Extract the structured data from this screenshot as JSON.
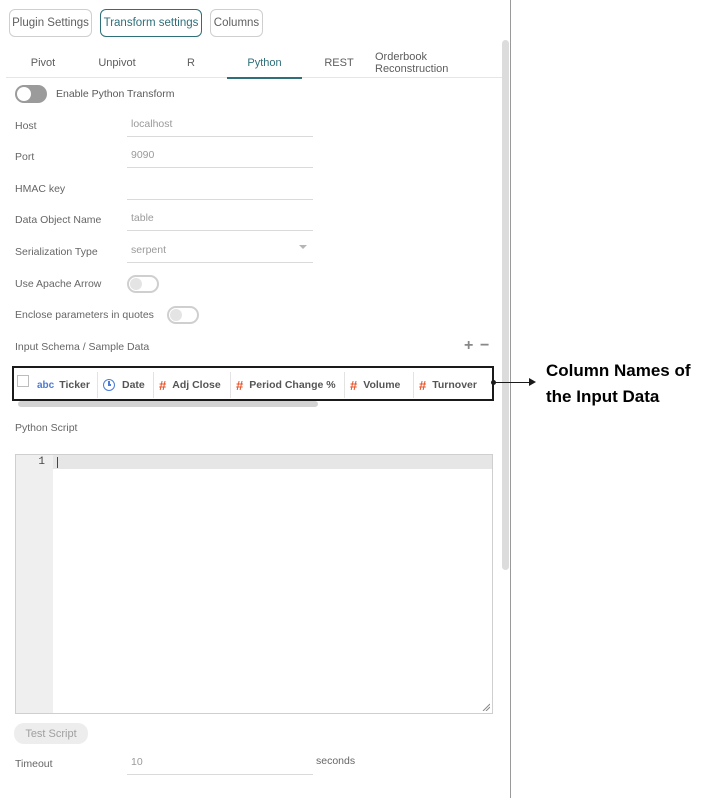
{
  "top_tabs": [
    "Plugin Settings",
    "Transform settings",
    "Columns"
  ],
  "sub_tabs": [
    "Pivot",
    "Unpivot",
    "R",
    "Python",
    "REST",
    "Orderbook Reconstruction"
  ],
  "enable_label": "Enable Python Transform",
  "fields": {
    "host": {
      "label": "Host",
      "value": "localhost"
    },
    "port": {
      "label": "Port",
      "value": "9090"
    },
    "hmac": {
      "label": "HMAC key",
      "value": ""
    },
    "data_object": {
      "label": "Data Object Name",
      "value": "table"
    },
    "serialization": {
      "label": "Serialization Type",
      "value": "serpent"
    }
  },
  "use_arrow_label": "Use Apache Arrow",
  "enclose_label": "Enclose parameters in quotes",
  "input_schema_label": "Input Schema / Sample Data",
  "plus": "+",
  "minus": "−",
  "columns": {
    "ticker": {
      "type": "abc",
      "name": "Ticker"
    },
    "date": {
      "name": "Date"
    },
    "adj_close": {
      "type": "#",
      "name": "Adj Close"
    },
    "period_change": {
      "type": "#",
      "name": "Period Change %"
    },
    "volume": {
      "type": "#",
      "name": "Volume"
    },
    "turnover": {
      "type": "#",
      "name": "Turnover"
    }
  },
  "python_script_label": "Python Script",
  "line_number": "1",
  "test_script": "Test Script",
  "timeout": {
    "label": "Timeout",
    "value": "10",
    "unit": "seconds"
  },
  "callout": [
    "Column Names of",
    "the Input Data"
  ],
  "colors": {
    "accent": "#2e6f7a",
    "number_type": "#e8542a",
    "text_type": "#4a7bd6"
  }
}
